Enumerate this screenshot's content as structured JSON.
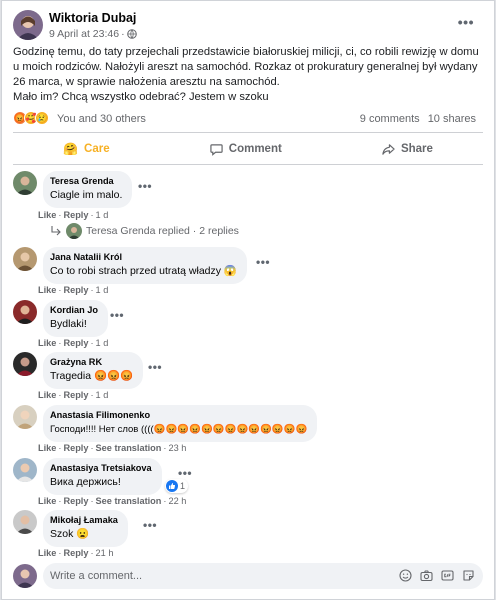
{
  "colors": {
    "link": "#65676b",
    "care": "#f7b125",
    "angry": "#f27b3a",
    "like": "#1877f2",
    "bubble": "#f0f2f5"
  },
  "post": {
    "author": "Wiktoria Dubaj",
    "timestamp": "9 April at 23:46",
    "privacy_icon": "globe-icon",
    "text_lines": [
      "Godzinę temu, do taty przejechali przedstawicie białoruskiej milicji, ci, co robili rewizję w domu u moich rodziców. Nałożyli areszt na samochód. Rozkaz ot prokuratury generalnej był wydany 26 marca, w sprawie nałożenia aresztu na samochód.",
      "Mało im? Chcą wszystko odebrać? Jestem w szoku"
    ],
    "reactions_text": "You and 30 others",
    "comments_count": "9 comments",
    "shares_count": "10 shares"
  },
  "actions": {
    "care": "Care",
    "comment": "Comment",
    "share": "Share"
  },
  "comment_actions": {
    "like": "Like",
    "reply": "Reply",
    "see_translation": "See translation"
  },
  "comments": [
    {
      "name": "Teresa Grenda",
      "text": "Ciagle im malo.",
      "time": "1 d"
    },
    {
      "name": "Jana Natalii Król",
      "text": "Co to robi strach przed utratą władzy 😱",
      "time": "1 d"
    },
    {
      "name": "Kordian Jo",
      "text": "Bydlaki!",
      "time": "1 d"
    },
    {
      "name": "Grażyna RK",
      "text": "Tragedia 😡😡😡",
      "time": "1 d"
    },
    {
      "name": "Anastasia Filimonenko",
      "text": "Господи!!!! Нет слов ((((😡😡😡😡😡😡😡😡😡😡😡😡😡",
      "time": "23 h"
    },
    {
      "name": "Anastasiya Tretsiakova",
      "text": "Вика держись!",
      "time": "22 h",
      "like_count": "1"
    },
    {
      "name": "Mikołaj Łamaka",
      "text": "Szok 😦",
      "time": "21 h"
    }
  ],
  "replies": {
    "author": "Teresa Grenda",
    "text": "Teresa Grenda replied · 2 replies"
  },
  "composer": {
    "placeholder": "Write a comment..."
  }
}
